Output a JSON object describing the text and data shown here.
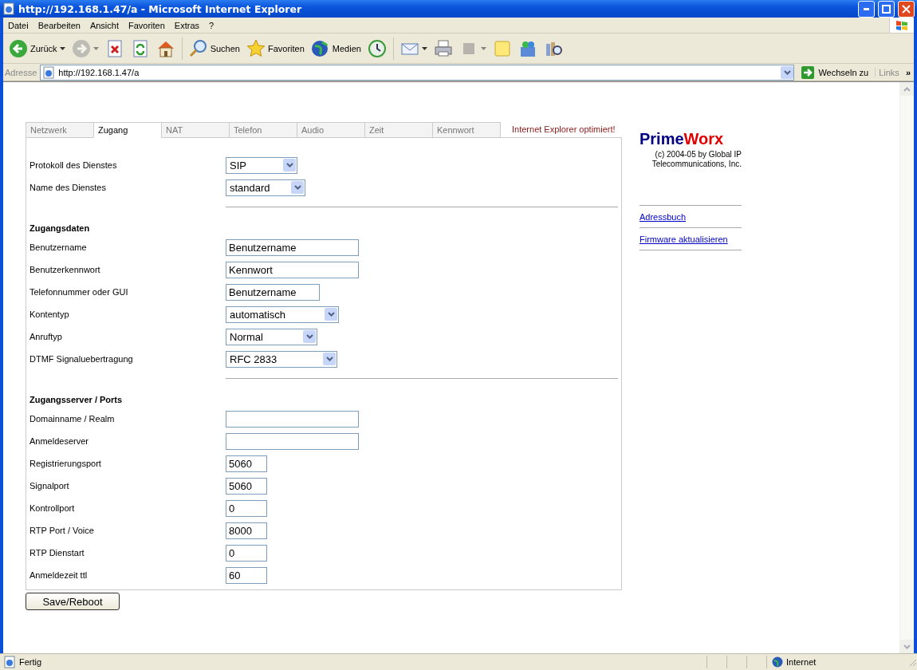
{
  "window": {
    "title": "http://192.168.1.47/a - Microsoft Internet Explorer"
  },
  "menu": [
    "Datei",
    "Bearbeiten",
    "Ansicht",
    "Favoriten",
    "Extras",
    "?"
  ],
  "toolbar": [
    {
      "kind": "back",
      "label": "Zurück",
      "dropdown": true,
      "disabled": false
    },
    {
      "kind": "forward",
      "dropdown": true,
      "disabled": true
    },
    {
      "kind": "stop",
      "dropdown": false,
      "disabled": false
    },
    {
      "kind": "refresh",
      "dropdown": false,
      "disabled": false
    },
    {
      "kind": "home",
      "dropdown": false,
      "disabled": false
    },
    {
      "kind": "search",
      "label": "Suchen",
      "dropdown": false,
      "disabled": false
    },
    {
      "kind": "favorites",
      "label": "Favoriten",
      "dropdown": false,
      "disabled": false
    },
    {
      "kind": "media",
      "label": "Medien",
      "dropdown": false,
      "disabled": false
    },
    {
      "kind": "history",
      "dropdown": false,
      "disabled": false
    },
    {
      "kind": "mail",
      "dropdown": true,
      "disabled": false
    },
    {
      "kind": "print",
      "dropdown": false,
      "disabled": false
    },
    {
      "kind": "edit",
      "dropdown": true,
      "disabled": true
    },
    {
      "kind": "note",
      "dropdown": false,
      "disabled": false
    },
    {
      "kind": "messenger",
      "dropdown": false,
      "disabled": false
    },
    {
      "kind": "research",
      "dropdown": false,
      "disabled": false
    }
  ],
  "address": {
    "label": "Adresse",
    "url": "http://192.168.1.47/a",
    "go": "Wechseln zu",
    "links": "Links",
    "more": "»"
  },
  "tabs": [
    {
      "label": "Netzwerk",
      "selected": false
    },
    {
      "label": "Zugang",
      "selected": true
    },
    {
      "label": "NAT",
      "selected": false
    },
    {
      "label": "Telefon",
      "selected": false
    },
    {
      "label": "Audio",
      "selected": false
    },
    {
      "label": "Zeit",
      "selected": false
    },
    {
      "label": "Kennwort",
      "selected": false
    }
  ],
  "notice": "Internet Explorer optimiert!",
  "sections": [
    {
      "rows": [
        {
          "label": "Protokoll des Dienstes",
          "kind": "select",
          "value": "SIP"
        },
        {
          "label": "Name des Dienstes",
          "kind": "select",
          "value": "standard"
        }
      ]
    },
    {
      "heading": "Zugangsdaten",
      "rows": [
        {
          "label": "Benutzername",
          "kind": "text",
          "value": "Benutzername"
        },
        {
          "label": "Benutzerkennwort",
          "kind": "text",
          "value": "Kennwort"
        },
        {
          "label": "Telefonnummer oder GUI",
          "kind": "text",
          "value": "Benutzername"
        },
        {
          "label": "Kontentyp",
          "kind": "select",
          "value": "automatisch"
        },
        {
          "label": "Anruftyp",
          "kind": "select",
          "value": "Normal"
        },
        {
          "label": "DTMF Signaluebertragung",
          "kind": "select",
          "value": "RFC 2833"
        }
      ]
    },
    {
      "heading": "Zugangsserver / Ports",
      "rows": [
        {
          "label": "Domainname / Realm",
          "kind": "text"
        },
        {
          "label": "Anmeldeserver",
          "kind": "text"
        },
        {
          "label": "Registrierungsport",
          "kind": "text",
          "value": "5060"
        },
        {
          "label": "Signalport",
          "kind": "text",
          "value": "5060"
        },
        {
          "label": "Kontrollport",
          "kind": "text",
          "value": "0"
        },
        {
          "label": "RTP Port / Voice",
          "kind": "text",
          "value": "8000"
        },
        {
          "label": "RTP Dienstart",
          "kind": "text",
          "value": "0"
        },
        {
          "label": "Anmeldezeit ttl",
          "kind": "text",
          "value": "60"
        }
      ]
    }
  ],
  "save_button": "Save/Reboot",
  "logo": [
    {
      "text": "Prime",
      "kind": "dark"
    },
    {
      "text": "Worx",
      "kind": "accent"
    }
  ],
  "copyright": "(c) 2004-05 by Global IP Telecommunications, Inc.",
  "links": [
    "Adressbuch",
    "Firmware aktualisieren"
  ],
  "status": {
    "text": "Fertig",
    "zone": "Internet"
  }
}
